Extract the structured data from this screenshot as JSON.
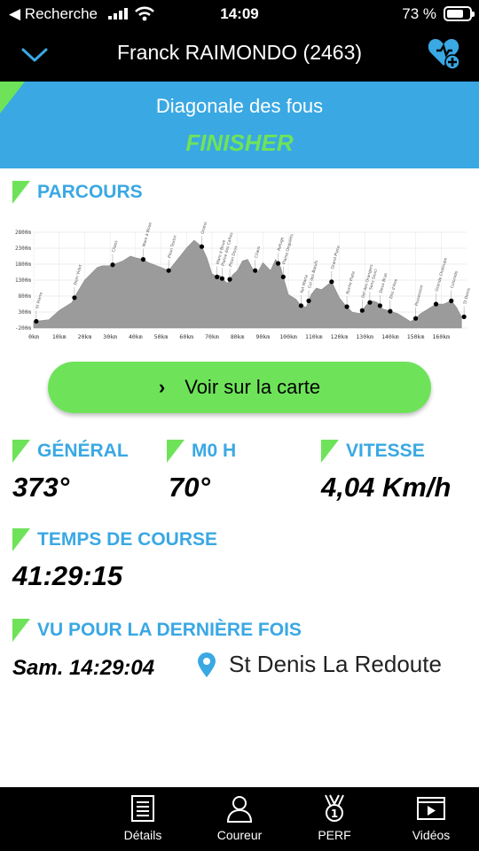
{
  "status_bar": {
    "back_app": "◀ Recherche",
    "time": "14:09",
    "battery": "73 %"
  },
  "header": {
    "title": "Franck RAIMONDO (2463)"
  },
  "race": {
    "name": "Diagonale des fous",
    "status": "FINISHER"
  },
  "parcours": {
    "title": "PARCOURS",
    "chart_data": {
      "type": "area",
      "x_unit": "km",
      "x_ticks": [
        "0km",
        "10km",
        "20km",
        "30km",
        "40km",
        "50km",
        "60km",
        "70km",
        "80km",
        "90km",
        "100km",
        "110km",
        "120km",
        "130km",
        "140km",
        "150km",
        "160km"
      ],
      "y_ticks": [
        "2800m",
        "2300m",
        "1800m",
        "1300m",
        "800m",
        "300m",
        "-200m"
      ],
      "xlim": [
        0,
        170
      ],
      "ylim": [
        -200,
        2800
      ],
      "elevation_km": [
        0,
        3,
        6,
        10,
        15,
        17,
        20,
        25,
        27,
        30,
        35,
        38,
        40,
        43,
        45,
        50,
        53,
        56,
        60,
        63,
        66,
        68,
        70,
        72,
        73,
        74,
        76,
        78,
        80,
        82,
        84,
        86,
        88,
        90,
        93,
        95,
        97,
        98,
        100,
        103,
        105,
        107,
        109,
        111,
        113,
        117,
        120,
        122,
        125,
        128,
        131,
        133,
        135,
        137,
        139,
        141,
        143,
        145,
        148,
        150,
        152,
        155,
        158,
        161,
        164,
        166,
        168
      ],
      "elevation_m": [
        0,
        30,
        60,
        350,
        600,
        900,
        1300,
        1700,
        1750,
        1750,
        1900,
        2050,
        2000,
        1950,
        1850,
        1700,
        1600,
        1900,
        2300,
        2550,
        2350,
        2000,
        1500,
        1400,
        1450,
        1350,
        1200,
        1450,
        1600,
        1900,
        1950,
        1650,
        1550,
        1850,
        1600,
        1950,
        1700,
        1400,
        850,
        700,
        500,
        450,
        850,
        1050,
        1000,
        1250,
        750,
        550,
        300,
        250,
        550,
        650,
        600,
        400,
        350,
        300,
        250,
        150,
        0,
        100,
        250,
        400,
        550,
        550,
        650,
        450,
        150
      ],
      "checkpoints_km": [
        1,
        16,
        31,
        43,
        53,
        66,
        72,
        74,
        77,
        87,
        96,
        98,
        105,
        108,
        117,
        123,
        129,
        132,
        136,
        140,
        150,
        158,
        164,
        169
      ],
      "checkpoint_labels": [
        "St Pierre",
        "Dom Vidot",
        "Cilaos",
        "Mare à Boue",
        "Piton Textor",
        "Oratoire",
        "Mare à Boue",
        "Plaine des Cafres",
        "Piton Doux",
        "Cilaos",
        "Refuge",
        "Plaine Ongulets",
        "Ilet Marla",
        "Col des Bœufs",
        "Grand Place",
        "Roche Plate",
        "Ilet des Orangers",
        "Sans Souci",
        "Deux Bras",
        "Dos d'Ane",
        "Possession",
        "Grande Chaloupe",
        "Colorado",
        "St Denis"
      ]
    }
  },
  "map_button": {
    "arrow": "›",
    "label": "Voir sur la carte"
  },
  "stats": {
    "general_label": "GÉNÉRAL",
    "general_value": "373°",
    "category_label": "M0 H",
    "category_value": "70°",
    "speed_label": "VITESSE",
    "speed_value": "4,04 Km/h"
  },
  "race_time": {
    "label": "TEMPS DE COURSE",
    "value": "41:29:15"
  },
  "last_seen": {
    "label": "VU POUR LA DERNIÈRE FOIS",
    "time": "Sam. 14:29:04",
    "location": "St Denis La Redoute"
  },
  "tabs": [
    {
      "label": "Détails",
      "icon": "list-icon"
    },
    {
      "label": "Coureur",
      "icon": "person-icon"
    },
    {
      "label": "PERF",
      "icon": "medal-icon"
    },
    {
      "label": "Vidéos",
      "icon": "video-icon"
    }
  ],
  "colors": {
    "accent_blue": "#3aa8e3",
    "accent_green": "#6ee35a",
    "bar_black": "#000000"
  }
}
